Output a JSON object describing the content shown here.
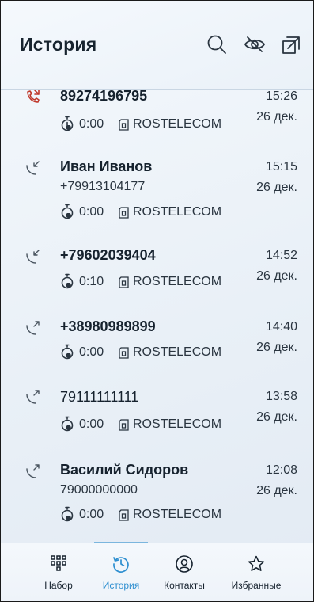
{
  "header": {
    "title": "История"
  },
  "calls": [
    {
      "name": "89274196795",
      "number": "",
      "duration": "0:00",
      "operator": "ROSTELECOM",
      "time": "15:26",
      "date": "26 дек.",
      "direction": "missed"
    },
    {
      "name": "Иван Иванов",
      "number": "+79913104177",
      "duration": "0:00",
      "operator": "ROSTELECOM",
      "time": "15:15",
      "date": "26 дек.",
      "direction": "incoming"
    },
    {
      "name": "+79602039404",
      "number": "",
      "duration": "0:10",
      "operator": "ROSTELECOM",
      "time": "14:52",
      "date": "26 дек.",
      "direction": "incoming"
    },
    {
      "name": "+38980989899",
      "number": "",
      "duration": "0:00",
      "operator": "ROSTELECOM",
      "time": "14:40",
      "date": "26 дек.",
      "direction": "outgoing"
    },
    {
      "name": "79111111111",
      "number": "",
      "duration": "0:00",
      "operator": "ROSTELECOM",
      "time": "13:58",
      "date": "26 дек.",
      "direction": "outgoing"
    },
    {
      "name": "Василий Сидоров",
      "number": "79000000000",
      "duration": "0:00",
      "operator": "ROSTELECOM",
      "time": "12:08",
      "date": "26 дек.",
      "direction": "outgoing"
    }
  ],
  "nav": {
    "items": [
      {
        "label": "Набор",
        "icon": "dialpad-icon"
      },
      {
        "label": "История",
        "icon": "history-icon"
      },
      {
        "label": "Контакты",
        "icon": "contacts-icon"
      },
      {
        "label": "Избранные",
        "icon": "star-icon"
      }
    ],
    "active": "История"
  },
  "colors": {
    "accent": "#2e8fd0",
    "missed": "#c0392b",
    "text": "#16222e"
  }
}
